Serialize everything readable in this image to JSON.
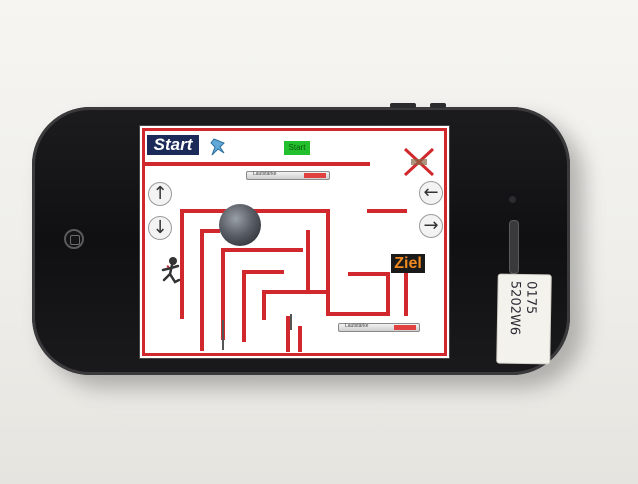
{
  "game": {
    "start_label": "Start",
    "goal_label": "Ziel",
    "green_badge": "Start",
    "top_bar_label": "Lautstärke",
    "bottom_bar_label": "Lautstärke"
  },
  "sticker": {
    "line1": "0175",
    "line2": "5202W6"
  },
  "colors": {
    "maze_wall": "#d0282d",
    "start_bg": "#1c2a5a",
    "goal_text": "#f08a20",
    "green_badge": "#22c02c"
  },
  "icons": [
    "pin-icon",
    "x-icon",
    "arrow-up-icon",
    "arrow-down-icon",
    "arrow-left-icon",
    "arrow-right-icon",
    "runner-figure"
  ]
}
